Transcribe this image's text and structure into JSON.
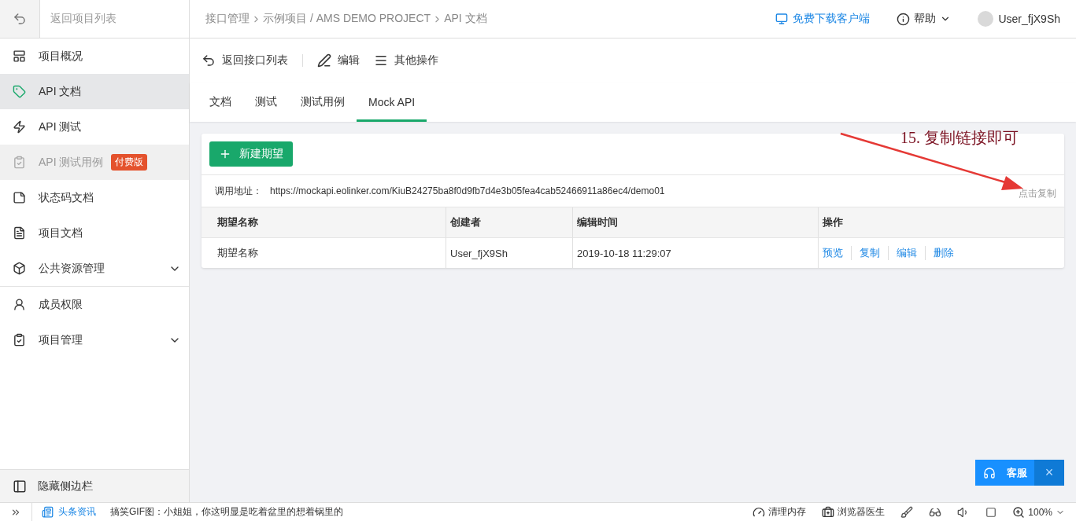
{
  "sidebar": {
    "back": {
      "label": "返回项目列表"
    },
    "items": [
      {
        "label": "项目概况",
        "selected": false,
        "disabled": false,
        "submenu": false
      },
      {
        "label": "API 文档",
        "selected": true,
        "disabled": false,
        "submenu": false
      },
      {
        "label": "API 测试",
        "selected": false,
        "disabled": false,
        "submenu": false
      },
      {
        "label": "API 测试用例",
        "selected": false,
        "disabled": true,
        "submenu": false,
        "badge": "付费版"
      },
      {
        "label": "状态码文档",
        "selected": false,
        "disabled": false,
        "submenu": false
      },
      {
        "label": "项目文档",
        "selected": false,
        "disabled": false,
        "submenu": false
      },
      {
        "label": "公共资源管理",
        "selected": false,
        "disabled": false,
        "submenu": true
      },
      {
        "label": "成员权限",
        "selected": false,
        "disabled": false,
        "submenu": false
      },
      {
        "label": "项目管理",
        "selected": false,
        "disabled": false,
        "submenu": true
      }
    ],
    "hide": {
      "label": "隐藏侧边栏"
    }
  },
  "header": {
    "breadcrumb": [
      "接口管理",
      "示例项目 / AMS DEMO PROJECT",
      "API 文档"
    ],
    "download": "免费下载客户端",
    "help": "帮助",
    "user": "User_fjX9Sh"
  },
  "toolbar": [
    "返回接口列表",
    "编辑",
    "其他操作"
  ],
  "tabs": [
    {
      "label": "文档",
      "selected": false
    },
    {
      "label": "测试",
      "selected": false
    },
    {
      "label": "测试用例",
      "selected": false
    },
    {
      "label": "Mock API",
      "selected": true
    }
  ],
  "card": {
    "new_button": "新建期望",
    "url_label": "调用地址：",
    "url": "https://mockapi.eolinker.com/KiuB24275ba8f0d9fb7d4e3b05fea4cab52466911a86ec4/demo01",
    "copy": "点击复制",
    "table": {
      "columns": [
        "期望名称",
        "创建者",
        "编辑时间",
        "操作"
      ],
      "rows": [
        {
          "name": "期望名称",
          "creator": "User_fjX9Sh",
          "time": "2019-10-18 11:29:07",
          "actions": [
            "预览",
            "复制",
            "编辑",
            "删除"
          ]
        }
      ]
    }
  },
  "annotation": "15. 复制链接即可",
  "service": {
    "label": "客服",
    "close": "×"
  },
  "status_bar": {
    "news_label": "头条资讯",
    "news": "搞笑GIF图：小姐姐，你这明显是吃着盆里的想着锅里的",
    "clean": "清理内存",
    "doctor": "浏览器医生",
    "zoom": "100%"
  }
}
